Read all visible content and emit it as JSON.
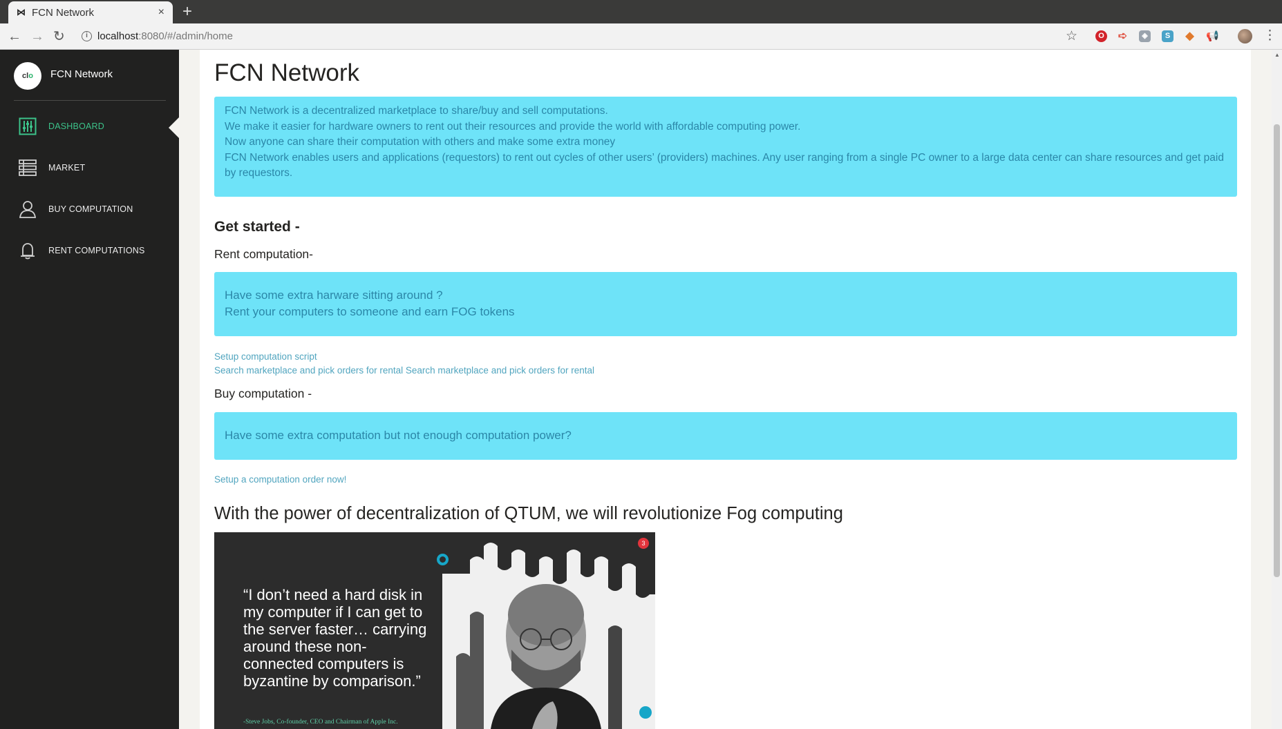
{
  "browser": {
    "tab_title": "FCN Network",
    "tab_close": "×",
    "new_tab": "+",
    "url_host": "localhost",
    "url_rest": ":8080/#/admin/home"
  },
  "sidebar": {
    "logo_text_a": "cl",
    "logo_text_b": "o",
    "brand": "FCN Network",
    "items": [
      {
        "label": "DASHBOARD",
        "icon": "sliders-icon",
        "active": true
      },
      {
        "label": "MARKET",
        "icon": "list-icon",
        "active": false
      },
      {
        "label": "BUY COMPUTATION",
        "icon": "user-icon",
        "active": false
      },
      {
        "label": "RENT COMPUTATIONS",
        "icon": "bell-icon",
        "active": false
      }
    ]
  },
  "main": {
    "title": "FCN Network",
    "intro": [
      "FCN Network is a decentralized marketplace to share/buy and sell computations.",
      "We make it easier for hardware owners to rent out their resources and provide the world with affordable computing power.",
      "Now anyone can share their computation with others and make some extra money",
      "FCN Network enables users and applications (requestors) to rent out cycles of other users’ (providers) machines. Any user ranging from a single PC owner to a large data center can share resources and get paid by requestors."
    ],
    "get_started": "Get started -",
    "rent_heading": "Rent computation-",
    "rent_alert_line1": "Have some extra harware sitting around ?",
    "rent_alert_line2": "Rent your computers to someone and earn FOG tokens",
    "link_setup_script": "Setup computation script",
    "link_search_market": "Search marketplace and pick orders for rental Search marketplace and pick orders for rental",
    "buy_heading": "Buy computation -",
    "buy_alert": "Have some extra computation but not enough computation power?",
    "link_setup_order": "Setup a computation order now!",
    "qtum_heading": "With the power of decentralization of QTUM, we will revolutionize Fog computing",
    "quote": "“I don’t need a hard disk in my computer if I can get to the server faster… carrying around these non-connected computers is byzantine by comparison.”",
    "quote_attr": "-Steve Jobs, Co-founder, CEO and Chairman of Apple Inc.",
    "image_badge": "3"
  },
  "colors": {
    "sidebar_bg": "#212120",
    "accent_green": "#3cc38a",
    "alert_bg": "#6ee3f8",
    "alert_text": "#2b87a8",
    "link": "#51a5bf"
  }
}
